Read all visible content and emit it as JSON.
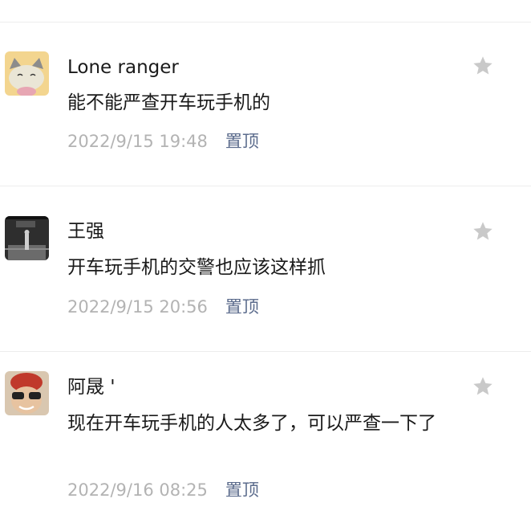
{
  "comments": [
    {
      "username": "Lone ranger",
      "content": "能不能严查开车玩手机的",
      "timestamp": "2022/9/15 19:48",
      "pin_label": "置顶"
    },
    {
      "username": "王强",
      "content": "开车玩手机的交警也应该这样抓",
      "timestamp": "2022/9/15 20:56",
      "pin_label": "置顶"
    },
    {
      "username": "阿晟 '",
      "content": "现在开车玩手机的人太多了，可以严查一下了",
      "timestamp": "2022/9/16 08:25",
      "pin_label": "置顶"
    }
  ],
  "colors": {
    "star": "#c9c9c9",
    "pin": "#5b6b8c",
    "timestamp": "#b3b3b3",
    "divider": "#ededed"
  },
  "icons": {
    "star": "star-icon",
    "pin": "pin-to-top"
  }
}
